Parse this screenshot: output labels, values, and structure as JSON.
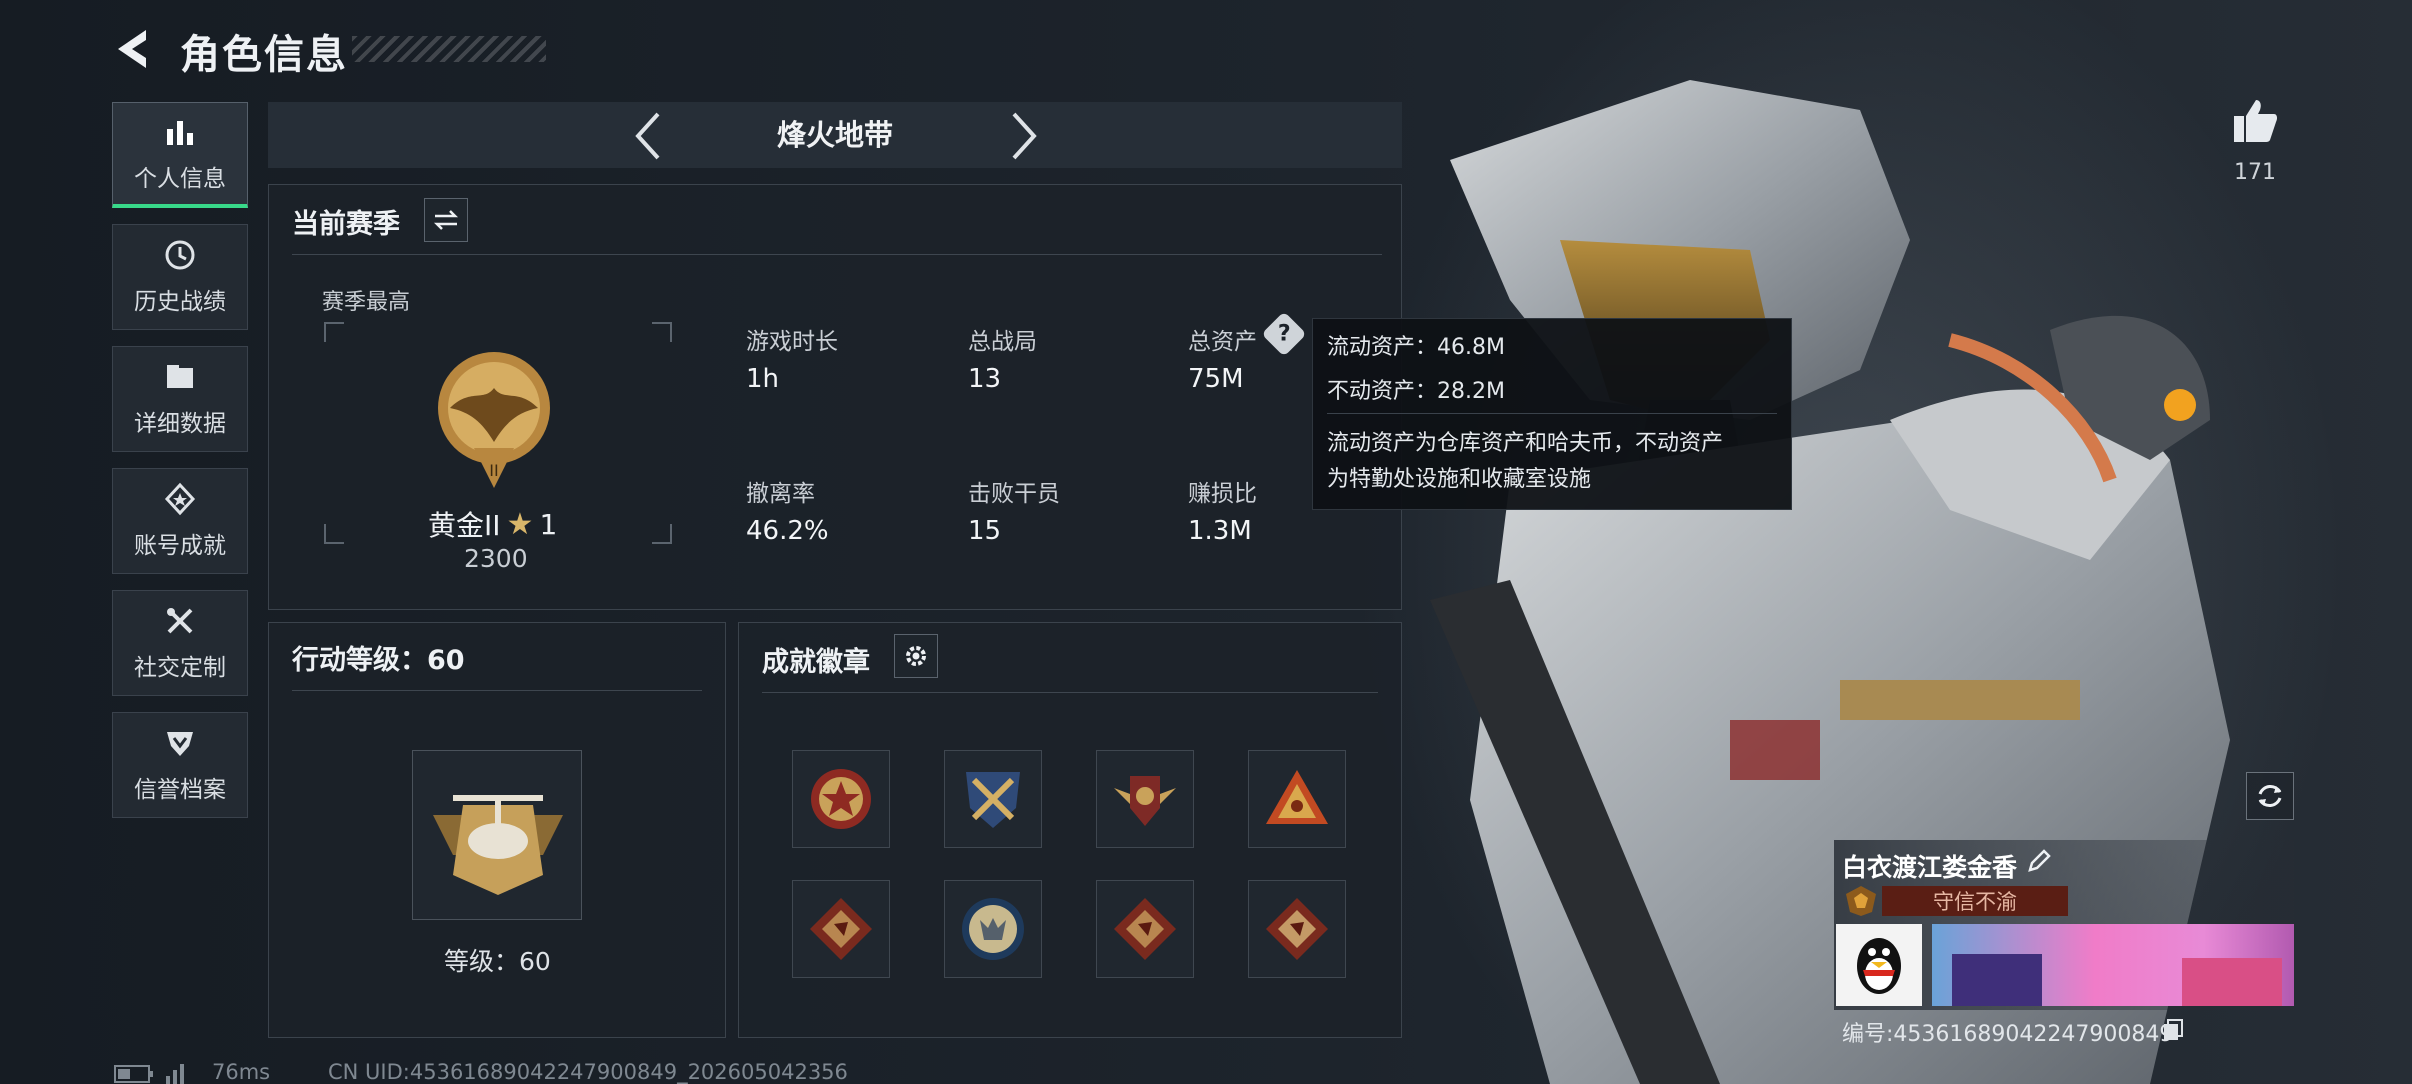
{
  "header": {
    "title": "角色信息"
  },
  "sidebar": {
    "items": [
      {
        "label": "个人信息",
        "icon": "bar-chart-icon",
        "active": true
      },
      {
        "label": "历史战绩",
        "icon": "history-icon",
        "active": false
      },
      {
        "label": "详细数据",
        "icon": "folder-icon",
        "active": false
      },
      {
        "label": "账号成就",
        "icon": "achievement-icon",
        "active": false
      },
      {
        "label": "社交定制",
        "icon": "tools-icon",
        "active": false
      },
      {
        "label": "信誉档案",
        "icon": "credit-shield-icon",
        "active": false
      }
    ]
  },
  "mode": {
    "title": "烽火地带"
  },
  "season": {
    "title": "当前赛季",
    "best_label": "赛季最高",
    "rank_name": "黄金II",
    "rank_stars": "1",
    "rank_score": "2300",
    "stats": [
      {
        "label": "游戏时长",
        "value": "1h"
      },
      {
        "label": "总战局",
        "value": "13"
      },
      {
        "label": "总资产",
        "value": "75M"
      },
      {
        "label": "撤离率",
        "value": "46.2%"
      },
      {
        "label": "击败干员",
        "value": "15"
      },
      {
        "label": "赚损比",
        "value": "1.3M"
      }
    ]
  },
  "tooltip": {
    "liquid": "流动资产：46.8M",
    "fixed": "不动资产：28.2M",
    "desc1": "流动资产为仓库资产和哈夫币，不动资产",
    "desc2": "为特勤处设施和收藏室设施"
  },
  "action_level": {
    "title": "行动等级：60",
    "level_text": "等级：60"
  },
  "badges": {
    "title": "成就徽章",
    "items": [
      "star-emblem-icon",
      "crossed-arms-emblem-icon",
      "winged-shield-emblem-icon",
      "triangle-emblem-icon",
      "dragon-diamond-icon",
      "wolf-round-icon",
      "dragon-diamond-icon",
      "dragon-diamond-icon"
    ]
  },
  "profile": {
    "like_count": "171",
    "player_name": "白衣渡江娄金香",
    "title_tag": "守信不渝",
    "id_text": "编号:45361689042247900849"
  },
  "status_bar": {
    "ping": "76ms",
    "uid": "CN UID:45361689042247900849_202605042356"
  },
  "colors": {
    "accent_active": "#38d98a",
    "tag_bg": "#5a1e14",
    "gold": "#c9a25a"
  }
}
